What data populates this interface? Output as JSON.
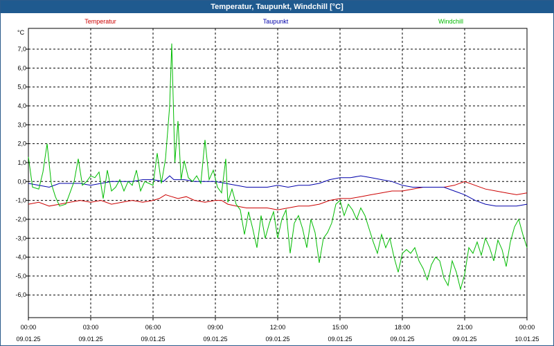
{
  "window": {
    "title": "Temperatur, Taupunkt, Windchill [°C]"
  },
  "chart_data": {
    "type": "line",
    "title": "Temperatur, Taupunkt, Windchill [°C]",
    "ylabel": "°C",
    "ylim": [
      -7.2,
      8.1
    ],
    "xlim": [
      0,
      24
    ],
    "grid": true,
    "y_ticks": [
      "7,0",
      "6,0",
      "5,0",
      "4,0",
      "3,0",
      "2,0",
      "1,0",
      "0,0",
      "-1,0",
      "-2,0",
      "-3,0",
      "-4,0",
      "-5,0",
      "-6,0"
    ],
    "y_tick_values": [
      7,
      6,
      5,
      4,
      3,
      2,
      1,
      0,
      -1,
      -2,
      -3,
      -4,
      -5,
      -6
    ],
    "x_ticks": [
      {
        "time": "00:00",
        "date": "09.01.25",
        "h": 0
      },
      {
        "time": "03:00",
        "date": "09.01.25",
        "h": 3
      },
      {
        "time": "06:00",
        "date": "09.01.25",
        "h": 6
      },
      {
        "time": "09:00",
        "date": "09.01.25",
        "h": 9
      },
      {
        "time": "12:00",
        "date": "09.01.25",
        "h": 12
      },
      {
        "time": "15:00",
        "date": "09.01.25",
        "h": 15
      },
      {
        "time": "18:00",
        "date": "09.01.25",
        "h": 18
      },
      {
        "time": "21:00",
        "date": "09.01.25",
        "h": 21
      },
      {
        "time": "00:00",
        "date": "10.01.25",
        "h": 24
      }
    ],
    "series": [
      {
        "name": "Temperatur",
        "color": "#cc0000",
        "points": [
          [
            0,
            -1.2
          ],
          [
            0.5,
            -1.1
          ],
          [
            1,
            -1.3
          ],
          [
            1.5,
            -1.2
          ],
          [
            2,
            -1.1
          ],
          [
            2.5,
            -1.0
          ],
          [
            3,
            -1.1
          ],
          [
            3.5,
            -1.0
          ],
          [
            4,
            -1.2
          ],
          [
            4.5,
            -1.1
          ],
          [
            5,
            -1.0
          ],
          [
            5.5,
            -1.1
          ],
          [
            6,
            -1.0
          ],
          [
            6.3,
            -0.9
          ],
          [
            6.6,
            -0.7
          ],
          [
            6.9,
            -0.8
          ],
          [
            7.2,
            -0.9
          ],
          [
            7.6,
            -0.8
          ],
          [
            8,
            -1.0
          ],
          [
            8.5,
            -1.1
          ],
          [
            9,
            -1.0
          ],
          [
            9.3,
            -1.0
          ],
          [
            9.6,
            -1.2
          ],
          [
            10,
            -1.3
          ],
          [
            10.5,
            -1.4
          ],
          [
            11,
            -1.4
          ],
          [
            11.5,
            -1.4
          ],
          [
            12,
            -1.5
          ],
          [
            12.5,
            -1.4
          ],
          [
            13,
            -1.3
          ],
          [
            13.5,
            -1.3
          ],
          [
            14,
            -1.2
          ],
          [
            14.5,
            -1.0
          ],
          [
            15,
            -0.9
          ],
          [
            15.5,
            -0.9
          ],
          [
            16,
            -0.8
          ],
          [
            16.5,
            -0.7
          ],
          [
            17,
            -0.6
          ],
          [
            17.5,
            -0.5
          ],
          [
            18,
            -0.5
          ],
          [
            18.5,
            -0.4
          ],
          [
            19,
            -0.3
          ],
          [
            19.5,
            -0.3
          ],
          [
            20,
            -0.3
          ],
          [
            20.5,
            -0.2
          ],
          [
            21,
            0.0
          ],
          [
            21.5,
            -0.2
          ],
          [
            22,
            -0.4
          ],
          [
            22.5,
            -0.5
          ],
          [
            23,
            -0.6
          ],
          [
            23.5,
            -0.7
          ],
          [
            24,
            -0.6
          ]
        ]
      },
      {
        "name": "Taupunkt",
        "color": "#0000aa",
        "points": [
          [
            0,
            -0.1
          ],
          [
            0.5,
            -0.2
          ],
          [
            1,
            -0.3
          ],
          [
            1.5,
            -0.1
          ],
          [
            2,
            -0.1
          ],
          [
            2.5,
            -0.1
          ],
          [
            3,
            -0.2
          ],
          [
            3.5,
            -0.1
          ],
          [
            4,
            0.0
          ],
          [
            4.5,
            0.0
          ],
          [
            5,
            0.0
          ],
          [
            5.5,
            0.1
          ],
          [
            6,
            0.1
          ],
          [
            6.5,
            0.0
          ],
          [
            6.8,
            0.3
          ],
          [
            7,
            0.1
          ],
          [
            7.5,
            0.1
          ],
          [
            8,
            0.0
          ],
          [
            8.5,
            0.0
          ],
          [
            9,
            0.0
          ],
          [
            9.5,
            -0.1
          ],
          [
            10,
            -0.2
          ],
          [
            10.5,
            -0.3
          ],
          [
            11,
            -0.3
          ],
          [
            11.5,
            -0.3
          ],
          [
            12,
            -0.2
          ],
          [
            12.5,
            -0.3
          ],
          [
            13,
            -0.2
          ],
          [
            13.5,
            -0.2
          ],
          [
            14,
            -0.1
          ],
          [
            14.5,
            0.1
          ],
          [
            15,
            0.2
          ],
          [
            15.5,
            0.2
          ],
          [
            16,
            0.3
          ],
          [
            16.5,
            0.2
          ],
          [
            17,
            0.1
          ],
          [
            17.5,
            0.0
          ],
          [
            18,
            -0.2
          ],
          [
            18.5,
            -0.3
          ],
          [
            19,
            -0.3
          ],
          [
            19.5,
            -0.3
          ],
          [
            20,
            -0.3
          ],
          [
            20.5,
            -0.5
          ],
          [
            21,
            -0.7
          ],
          [
            21.5,
            -1.0
          ],
          [
            22,
            -1.2
          ],
          [
            22.5,
            -1.3
          ],
          [
            23,
            -1.3
          ],
          [
            23.5,
            -1.3
          ],
          [
            24,
            -1.2
          ]
        ]
      },
      {
        "name": "Windchill",
        "color": "#00bb00",
        "points": [
          [
            0,
            1.3
          ],
          [
            0.2,
            -0.3
          ],
          [
            0.5,
            -0.4
          ],
          [
            0.7,
            0.5
          ],
          [
            0.9,
            2.0
          ],
          [
            1.1,
            -0.1
          ],
          [
            1.3,
            -0.8
          ],
          [
            1.5,
            -1.3
          ],
          [
            1.8,
            -1.2
          ],
          [
            2,
            -0.6
          ],
          [
            2.2,
            0.0
          ],
          [
            2.4,
            1.2
          ],
          [
            2.6,
            -0.2
          ],
          [
            2.8,
            0.0
          ],
          [
            3,
            0.3
          ],
          [
            3.2,
            0.2
          ],
          [
            3.4,
            0.5
          ],
          [
            3.6,
            -0.9
          ],
          [
            3.8,
            0.6
          ],
          [
            4,
            -0.5
          ],
          [
            4.2,
            -0.3
          ],
          [
            4.4,
            0.1
          ],
          [
            4.6,
            -0.5
          ],
          [
            4.8,
            0.0
          ],
          [
            5,
            -0.2
          ],
          [
            5.2,
            0.6
          ],
          [
            5.4,
            -0.5
          ],
          [
            5.6,
            0.0
          ],
          [
            5.8,
            -0.1
          ],
          [
            6,
            -0.2
          ],
          [
            6.2,
            1.5
          ],
          [
            6.4,
            -0.1
          ],
          [
            6.6,
            1.2
          ],
          [
            6.8,
            4.0
          ],
          [
            6.9,
            7.3
          ],
          [
            7.05,
            1.0
          ],
          [
            7.2,
            3.2
          ],
          [
            7.35,
            0.1
          ],
          [
            7.5,
            1.1
          ],
          [
            7.7,
            0.2
          ],
          [
            7.9,
            0.0
          ],
          [
            8.1,
            0.3
          ],
          [
            8.3,
            -0.1
          ],
          [
            8.5,
            2.2
          ],
          [
            8.7,
            0.1
          ],
          [
            8.9,
            0.6
          ],
          [
            9.1,
            -0.3
          ],
          [
            9.3,
            -0.6
          ],
          [
            9.5,
            1.2
          ],
          [
            9.6,
            -1.1
          ],
          [
            9.8,
            -0.4
          ],
          [
            10,
            -1.2
          ],
          [
            10.2,
            -1.5
          ],
          [
            10.4,
            -2.8
          ],
          [
            10.6,
            -1.6
          ],
          [
            10.8,
            -2.5
          ],
          [
            11,
            -3.5
          ],
          [
            11.2,
            -1.8
          ],
          [
            11.4,
            -3.0
          ],
          [
            11.6,
            -2.2
          ],
          [
            11.8,
            -1.6
          ],
          [
            12,
            -3.0
          ],
          [
            12.2,
            -2.0
          ],
          [
            12.4,
            -1.5
          ],
          [
            12.6,
            -3.8
          ],
          [
            12.8,
            -2.2
          ],
          [
            13,
            -1.8
          ],
          [
            13.2,
            -2.5
          ],
          [
            13.4,
            -3.5
          ],
          [
            13.6,
            -2.0
          ],
          [
            13.8,
            -2.7
          ],
          [
            14,
            -4.3
          ],
          [
            14.2,
            -3.0
          ],
          [
            14.4,
            -2.7
          ],
          [
            14.6,
            -2.2
          ],
          [
            14.8,
            -1.2
          ],
          [
            15,
            -1.0
          ],
          [
            15.2,
            -1.8
          ],
          [
            15.4,
            -1.2
          ],
          [
            15.6,
            -1.5
          ],
          [
            15.8,
            -2.0
          ],
          [
            16,
            -1.4
          ],
          [
            16.2,
            -1.8
          ],
          [
            16.4,
            -2.5
          ],
          [
            16.6,
            -3.2
          ],
          [
            16.8,
            -3.8
          ],
          [
            17,
            -2.8
          ],
          [
            17.2,
            -3.5
          ],
          [
            17.4,
            -3.0
          ],
          [
            17.6,
            -4.0
          ],
          [
            17.8,
            -4.8
          ],
          [
            18,
            -3.8
          ],
          [
            18.2,
            -3.6
          ],
          [
            18.4,
            -3.8
          ],
          [
            18.6,
            -3.5
          ],
          [
            18.8,
            -4.2
          ],
          [
            19,
            -4.6
          ],
          [
            19.2,
            -5.2
          ],
          [
            19.4,
            -4.4
          ],
          [
            19.6,
            -4.0
          ],
          [
            19.8,
            -4.2
          ],
          [
            20,
            -5.1
          ],
          [
            20.2,
            -5.5
          ],
          [
            20.4,
            -4.2
          ],
          [
            20.6,
            -4.8
          ],
          [
            20.8,
            -5.7
          ],
          [
            21,
            -4.9
          ],
          [
            21.2,
            -3.5
          ],
          [
            21.4,
            -3.8
          ],
          [
            21.6,
            -3.2
          ],
          [
            21.8,
            -3.9
          ],
          [
            22,
            -3.0
          ],
          [
            22.2,
            -3.5
          ],
          [
            22.4,
            -4.2
          ],
          [
            22.6,
            -3.1
          ],
          [
            22.8,
            -3.6
          ],
          [
            23,
            -4.5
          ],
          [
            23.2,
            -3.2
          ],
          [
            23.4,
            -2.4
          ],
          [
            23.6,
            -2.0
          ],
          [
            23.8,
            -2.8
          ],
          [
            24,
            -3.5
          ]
        ]
      }
    ]
  }
}
